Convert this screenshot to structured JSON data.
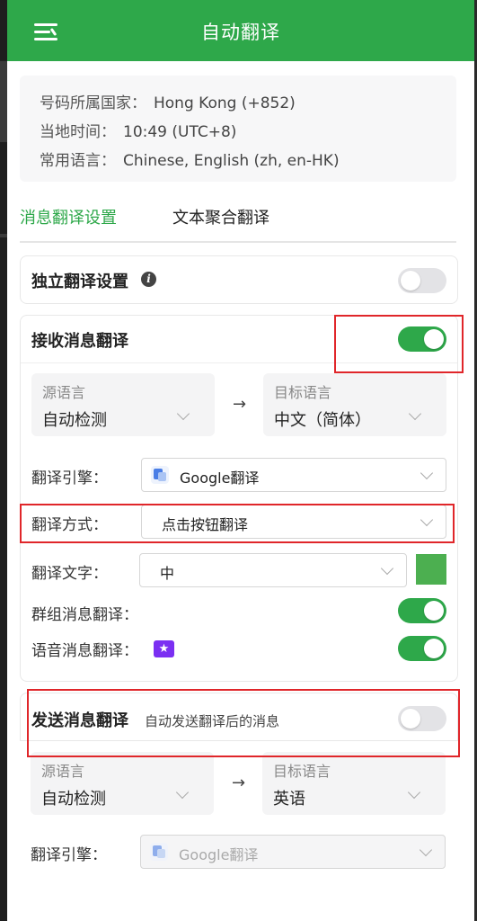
{
  "header": {
    "title": "自动翻译",
    "menu_icon": "menu-icon"
  },
  "info": {
    "country_label": "号码所属国家：",
    "country_value": "Hong Kong (+852)",
    "time_label": "当地时间：",
    "time_value": "10:49 (UTC+8)",
    "language_label": "常用语言：",
    "language_value": "Chinese, English (zh, en-HK)"
  },
  "tabs": [
    {
      "label": "消息翻译设置",
      "active": true
    },
    {
      "label": "文本聚合翻译",
      "active": false
    }
  ],
  "independent": {
    "title": "独立翻译设置",
    "enabled": false
  },
  "receive": {
    "title": "接收消息翻译",
    "enabled": true,
    "source_label": "源语言",
    "source_value": "自动检测",
    "arrow": "→",
    "target_label": "目标语言",
    "target_value": "中文（简体）",
    "engine_label": "翻译引擎：",
    "engine_value": "Google翻译",
    "mode_label": "翻译方式：",
    "mode_value": "点击按钮翻译",
    "text_label": "翻译文字：",
    "text_value": "中",
    "text_color": "#4caf50",
    "group_label": "群组消息翻译：",
    "group_enabled": true,
    "voice_label": "语音消息翻译：",
    "voice_badge_icon": "star-badge-icon",
    "voice_enabled": true
  },
  "send": {
    "title": "发送消息翻译",
    "subtitle": "自动发送翻译后的消息",
    "enabled": false,
    "source_label": "源语言",
    "source_value": "自动检测",
    "arrow": "→",
    "target_label": "目标语言",
    "target_value": "英语",
    "engine_label": "翻译引擎：",
    "engine_value": "Google翻译"
  },
  "colors": {
    "brand_green": "#2ea84a",
    "highlight_red": "#e0262a",
    "premium_purple": "#7b2ff2"
  }
}
